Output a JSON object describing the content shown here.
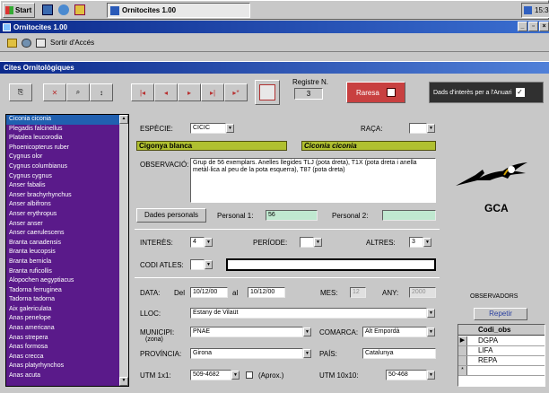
{
  "taskbar": {
    "start": "Start",
    "task": "Ornitocites 1.00",
    "clock": "15:3"
  },
  "titlebar": {
    "title": "Ornitocites 1.00"
  },
  "toolbar": {
    "exit_label": "Sortir d'Accés"
  },
  "window": {
    "title": "Cites Ornitològiques"
  },
  "nav": {
    "record_label": "Registre N.",
    "record_value": "3",
    "rarity_label": "Raresa",
    "annuari_label": "Dads d'interès per a l'Anuari"
  },
  "species_list": [
    "Ciconia ciconia",
    "Plegadis falcinellus",
    "Platalea leucorodia",
    "Phoenicopterus ruber",
    "Cygnus olor",
    "Cygnus columbianus",
    "Cygnus cygnus",
    "Anser fabalis",
    "Anser brachyrhynchus",
    "Anser albifrons",
    "Anser erythropus",
    "Anser anser",
    "Anser caerulescens",
    "Branta canadensis",
    "Branta leucopsis",
    "Branta bernicla",
    "Branta ruficollis",
    "Alopochen aegyptiacus",
    "Tadorna ferruginea",
    "Tadorna tadorna",
    "Aix galericulata",
    "Anas penelope",
    "Anas americana",
    "Anas strepera",
    "Anas formosa",
    "Anas crecca",
    "Anas platyrhynchos",
    "Anas acuta"
  ],
  "form": {
    "especie_label": "ESPÈCIE:",
    "especie_code": "CICIC",
    "raca_label": "RAÇA:",
    "common_name": "Cigonya blanca",
    "sci_name": "Ciconia ciconia",
    "obs_label": "OBSERVACIÓ:",
    "obs_text": "Grup de 56 exemplars. Anelles llegides TLJ (pota dreta), T1X (pota dreta i anella metàl·lica al peu de la pota esquerra), T87 (pota dreta)",
    "tab_label": "Dades personals",
    "pers1_label": "Personal 1:",
    "pers1_value": "56",
    "pers2_label": "Personal 2:",
    "interes_label": "INTERÈS:",
    "interes_value": "4",
    "periode_label": "PERÍODE:",
    "altres_label": "ALTRES:",
    "altres_value": "3",
    "codi_atles_label": "CODI ATLES:",
    "data_label": "DATA:",
    "del_label": "Del",
    "date_from": "10/12/00",
    "al_label": "al",
    "date_to": "10/12/00",
    "mes_label": "MES:",
    "mes_value": "12",
    "any_label": "ANY:",
    "any_value": "2000",
    "lloc_label": "LLOC:",
    "lloc_value": "Estany de Vilaüt",
    "municipi_label": "MUNICIPI:",
    "zona_label": "(zona)",
    "municipi_value": "PNAE",
    "comarca_label": "COMARCA:",
    "comarca_value": "Alt Empordà",
    "provincia_label": "PROVÍNCIA:",
    "provincia_value": "Girona",
    "pais_label": "PAÍS:",
    "pais_value": "Catalunya",
    "utm1_label": "UTM 1x1:",
    "utm1_value": "509-4682",
    "aprox_label": "(Aprox.)",
    "utm10_label": "UTM 10x10:",
    "utm10_value": "50-468"
  },
  "logo": {
    "text": "GCA"
  },
  "observadors": {
    "title": "OBSERVADORS",
    "repeat": "Repetir",
    "col": "Codi_obs",
    "rows": [
      "DGPA",
      "LIFA",
      "REPA"
    ]
  }
}
